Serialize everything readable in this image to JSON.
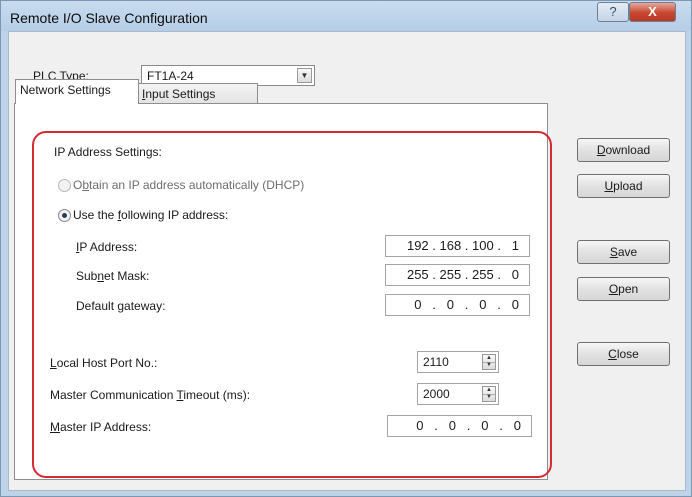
{
  "window": {
    "title": "Remote I/O Slave Configuration",
    "help_glyph": "?",
    "close_glyph": "X"
  },
  "plc_type": {
    "label_prefix": "",
    "label_accel": "P",
    "label_rest": "LC Type:",
    "value": "FT1A-24"
  },
  "tabs": [
    {
      "label": "Network Settings",
      "active": true
    },
    {
      "label_accel": "I",
      "label_rest": "nput Settings",
      "active": false
    }
  ],
  "network": {
    "section_title": "IP Address Settings:",
    "dhcp": {
      "pre": "O",
      "accel": "b",
      "rest": "tain an IP address automatically (DHCP)",
      "checked": false,
      "enabled": false
    },
    "static": {
      "pre": "Use the ",
      "accel": "f",
      "rest": "ollowing IP address:",
      "checked": true
    },
    "ip_address": {
      "accel": "I",
      "rest": "P Address:",
      "value": "192 . 168 . 100 .   1"
    },
    "subnet_mask": {
      "pre": "Sub",
      "accel": "n",
      "rest": "et Mask:",
      "value": "255 . 255 . 255 .   0"
    },
    "default_gateway": {
      "pre": "Default ",
      "accel": "g",
      "rest": "ateway:",
      "value": "0   .   0   .   0   .   0"
    },
    "local_host_port": {
      "accel": "L",
      "rest": "ocal Host Port No.:",
      "value": "2110"
    },
    "master_timeout": {
      "pre": "Master Communication ",
      "accel": "T",
      "rest": "imeout (ms):",
      "value": "2000"
    },
    "master_ip": {
      "accel": "M",
      "rest": "aster IP Address:",
      "value": "0   .   0   .   0   .   0"
    }
  },
  "buttons": {
    "download": {
      "accel": "D",
      "rest": "ownload"
    },
    "upload": {
      "accel": "U",
      "rest": "pload"
    },
    "save": {
      "accel": "S",
      "rest": "ave"
    },
    "open": {
      "accel": "O",
      "rest": "pen"
    },
    "close": {
      "accel": "C",
      "rest": "lose"
    }
  },
  "colors": {
    "highlight": "#d62a32",
    "titlebar": "#c3d7ec"
  }
}
